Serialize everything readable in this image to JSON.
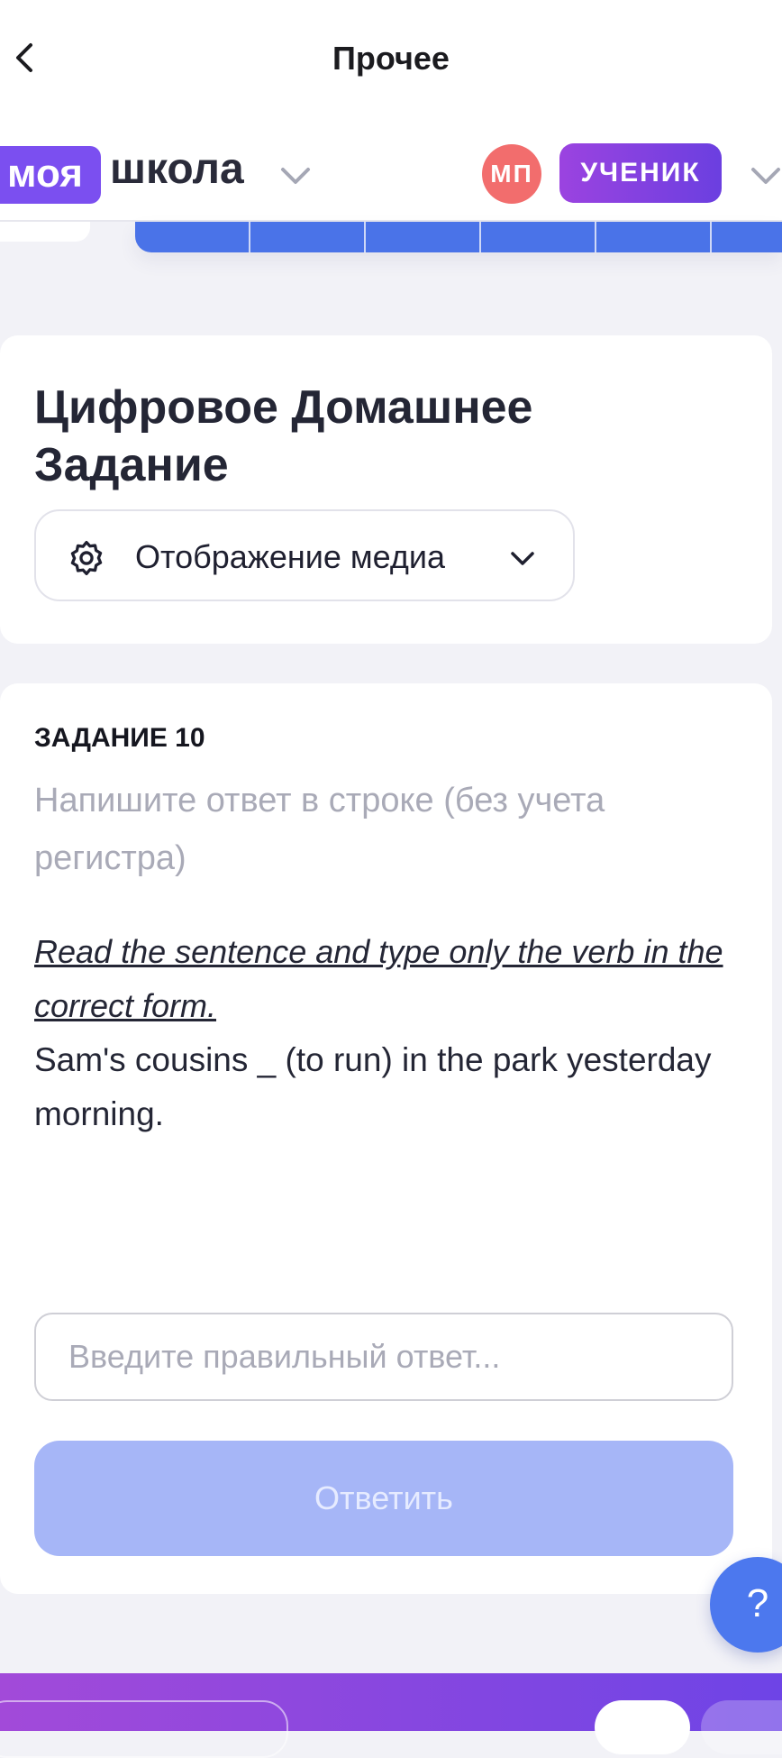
{
  "nav": {
    "title": "Прочее",
    "back_icon": "chevron-left-icon"
  },
  "header": {
    "logo_part1": "моя",
    "logo_part2": "школа",
    "avatar_initials": "МП",
    "role": "УЧЕНИК"
  },
  "homework": {
    "title": "Цифровое Домашнее Задание",
    "media_button_label": "Отображение медиа"
  },
  "task": {
    "number_label": "ЗАДАНИЕ 10",
    "instruction": "Напишите ответ в строке (без учета регистра)",
    "prompt": "Read the sentence and type only the verb in the correct form.",
    "sentence": "Sam's cousins _ (to run) in the park yesterday morning.",
    "answer_placeholder": "Введите правильный ответ...",
    "answer_value": "",
    "submit_label": "Ответить"
  },
  "help": {
    "label": "?"
  },
  "colors": {
    "accent_purple": "#7b4ff0",
    "blue": "#4a73e8",
    "submit_disabled": "#a6b6f7",
    "avatar": "#f26d6d"
  }
}
